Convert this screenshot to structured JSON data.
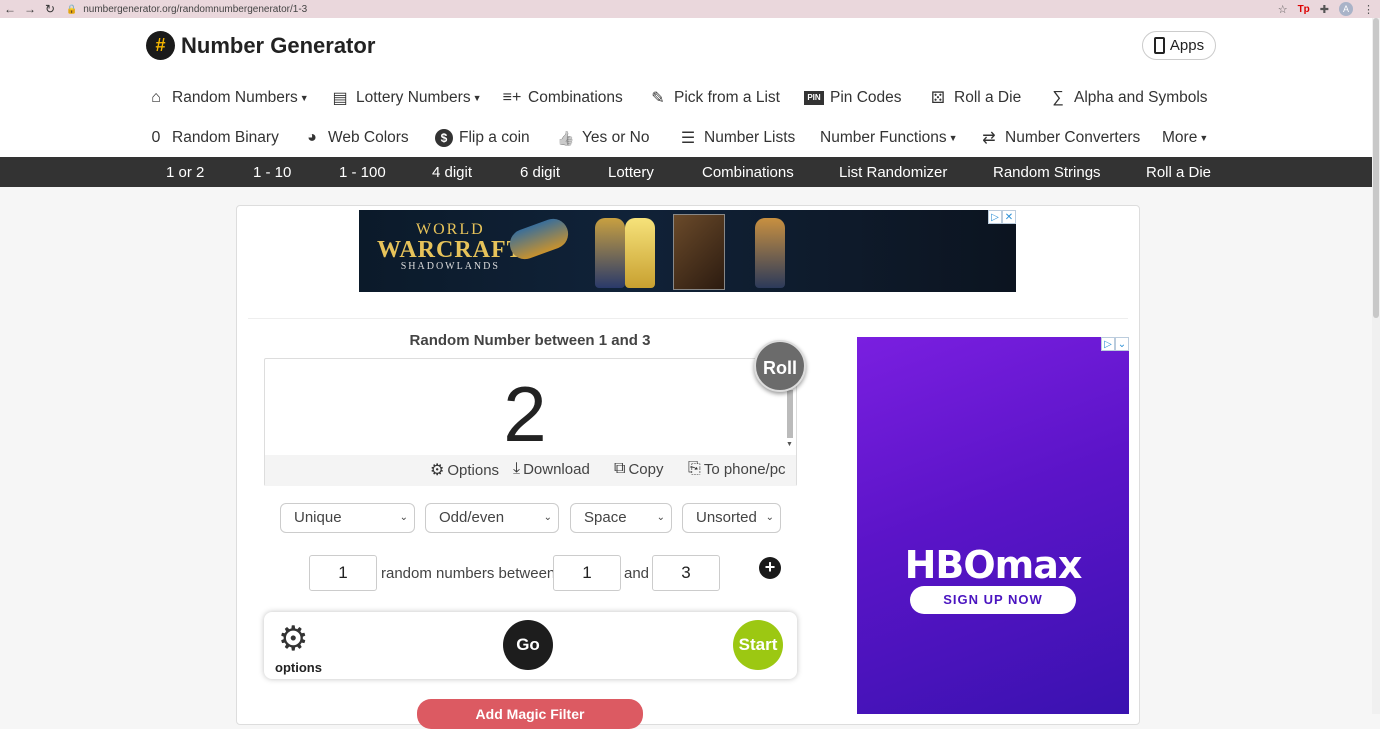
{
  "browser": {
    "url": "numbergenerator.org/randomnumbergenerator/1-3",
    "avatar_letter": "A",
    "ext_label": "Tp"
  },
  "site": {
    "logo_symbol": "#",
    "title": "Number Generator",
    "apps_label": "Apps"
  },
  "nav_row1": [
    {
      "label": "Random Numbers",
      "icon": "home-icon",
      "glyph": "⌂",
      "dropdown": true
    },
    {
      "label": "Lottery Numbers",
      "icon": "list-box-icon",
      "glyph": "▤",
      "dropdown": true
    },
    {
      "label": "Combinations",
      "icon": "playlist-add-icon",
      "glyph": "≡+",
      "dropdown": false
    },
    {
      "label": "Pick from a List",
      "icon": "pencil-icon",
      "glyph": "✎",
      "dropdown": false
    },
    {
      "label": "Pin Codes",
      "icon": "pin-icon",
      "glyph": "PIN",
      "dropdown": false
    },
    {
      "label": "Roll a Die",
      "icon": "die-icon",
      "glyph": "⚄",
      "dropdown": false
    },
    {
      "label": "Alpha and Symbols",
      "icon": "symbols-icon",
      "glyph": "∑",
      "dropdown": false
    }
  ],
  "nav_row2": [
    {
      "label": "Random Binary",
      "icon": "zero-icon",
      "glyph": "0",
      "dropdown": false
    },
    {
      "label": "Web Colors",
      "icon": "palette-icon",
      "glyph": "◕",
      "dropdown": false
    },
    {
      "label": "Flip a coin",
      "icon": "coin-icon",
      "glyph": "$",
      "dropdown": false
    },
    {
      "label": "Yes or No",
      "icon": "thumbs-icon",
      "glyph": "👍",
      "dropdown": false
    },
    {
      "label": "Number Lists",
      "icon": "numbered-list-icon",
      "glyph": "☰",
      "dropdown": false
    },
    {
      "label": "Number Functions",
      "icon": "",
      "glyph": "",
      "dropdown": true
    },
    {
      "label": "Number Converters",
      "icon": "swap-icon",
      "glyph": "⇄",
      "dropdown": false
    },
    {
      "label": "More",
      "icon": "",
      "glyph": "",
      "dropdown": true
    }
  ],
  "quick_links": [
    "1 or 2",
    "1 - 10",
    "1 - 100",
    "4 digit",
    "6 digit",
    "Lottery",
    "Combinations",
    "List Randomizer",
    "Random Strings",
    "Roll a Die"
  ],
  "ad_top": {
    "line1": "WORLD",
    "line2": "WARCRAFT",
    "line3": "SHADOWLANDS"
  },
  "generator": {
    "title": "Random Number between 1 and 3",
    "result": "2",
    "roll_label": "Roll",
    "tools": {
      "options": "Options",
      "download": "Download",
      "copy": "Copy",
      "to_phone": "To phone/pc"
    },
    "selects": {
      "unique": "Unique",
      "odd_even": "Odd/even",
      "separator": "Space",
      "sort": "Unsorted"
    },
    "count": "1",
    "count_label": "random numbers between",
    "min": "1",
    "and_label": "and",
    "max": "3",
    "plus_label": "+",
    "options_label": "options",
    "go_label": "Go",
    "start_label": "Start",
    "magic_label": "Add Magic Filter"
  },
  "ad_side": {
    "brand": "HBOmax",
    "cta": "SIGN UP NOW"
  },
  "colors": {
    "strip": "#333333",
    "start": "#9cc812",
    "magic": "#dc5a62",
    "hbo_purple": "#6a1ad8"
  }
}
